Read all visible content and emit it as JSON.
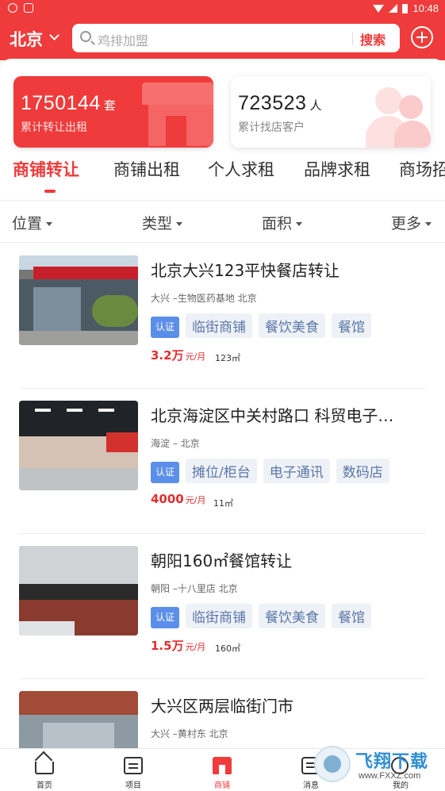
{
  "status_bar": {
    "time": "10:48"
  },
  "header": {
    "city": "北京",
    "search_placeholder": "鸡排加盟",
    "search_button": "搜索"
  },
  "stats": [
    {
      "number": "1750144",
      "unit": "套",
      "label": "累计转让出租"
    },
    {
      "number": "723523",
      "unit": "人",
      "label": "累计找店客户"
    }
  ],
  "tabs": [
    "商铺转让",
    "商铺出租",
    "个人求租",
    "品牌求租",
    "商场招"
  ],
  "filters": [
    "位置",
    "类型",
    "面积",
    "更多"
  ],
  "listings": [
    {
      "title": "北京大兴123平快餐店转让",
      "location": "大兴 –生物医药基地 北京",
      "badge": "认证",
      "tags": [
        "临街商铺",
        "餐饮美食",
        "餐馆"
      ],
      "price": "3.2万",
      "price_unit": "元/月",
      "area": "123㎡"
    },
    {
      "title": "北京海淀区中关村路口 科贸电子…",
      "location": "海淀 – 北京",
      "badge": "认证",
      "tags": [
        "摊位/柜台",
        "电子通讯",
        "数码店"
      ],
      "price": "4000",
      "price_unit": "元/月",
      "area": "11㎡"
    },
    {
      "title": "朝阳160㎡餐馆转让",
      "location": "朝阳 –十八里店 北京",
      "badge": "认证",
      "tags": [
        "临街商铺",
        "餐饮美食",
        "餐馆"
      ],
      "price": "1.5万",
      "price_unit": "元/月",
      "area": "160㎡"
    },
    {
      "title": "大兴区两层临街门市",
      "location": "大兴 –黄村东 北京"
    }
  ],
  "bottom_nav": [
    "首页",
    "项目",
    "商铺",
    "消息",
    "我的"
  ],
  "watermark": {
    "name": "飞翔下载",
    "url": "www.FXXZ.com"
  },
  "colors": {
    "accent": "#ef3b3b",
    "tag_text": "#5b77a8",
    "badge": "#5b8ee8"
  }
}
